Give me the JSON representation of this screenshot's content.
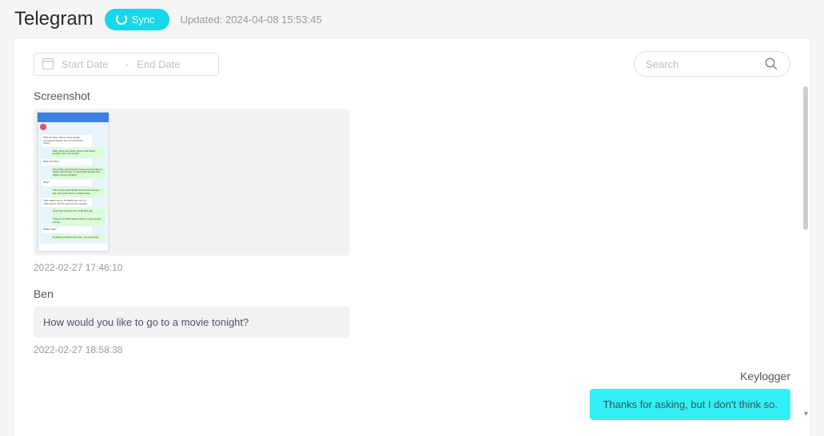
{
  "header": {
    "title": "Telegram",
    "sync_label": "Sync",
    "updated_prefix": "Updated: ",
    "updated_time": "2024-04-08 15:53:45"
  },
  "toolbar": {
    "start_placeholder": "Start Date",
    "end_placeholder": "End Date",
    "date_separator": "-",
    "search_placeholder": "Search"
  },
  "messages": [
    {
      "side": "left",
      "sender": "Screenshot",
      "type": "screenshot",
      "timestamp": "2022-02-27 17:46:10"
    },
    {
      "side": "left",
      "sender": "Ben",
      "type": "text",
      "text": "How would you like to go to a movie tonight?",
      "timestamp": "2022-02-27 18:58:38"
    },
    {
      "side": "right",
      "sender": "Keylogger",
      "type": "text",
      "text": "Thanks for asking, but I don't think so.",
      "timestamp": ""
    }
  ],
  "screenshot_preview": {
    "lines": [
      {
        "t": "Why are there still so many people overweight despite the current fitness craze?",
        "r": false
      },
      {
        "t": "Well, there are certain factors that affect people's size and weight.",
        "r": true
      },
      {
        "t": "What are they?",
        "r": false
      },
      {
        "t": "One study said that low-income groups have a higher percentage of overweight people than higher income families.",
        "r": true
      },
      {
        "t": "Why?",
        "r": false
      },
      {
        "t": "The survey said that the low-income groups ate more junk food on a daily basis.",
        "r": true
      },
      {
        "t": "That makes sense. Probably less time to make dinner and the junk food is cheaper.",
        "r": false
      },
      {
        "t": "Junk food contains lots of fat and salt.",
        "r": true
      },
      {
        "t": "There's one final reason why so many people are fat.",
        "r": true
      },
      {
        "t": "What's that?",
        "r": false
      },
      {
        "t": "Nobody exercises any more--not even kids.",
        "r": true
      }
    ]
  }
}
